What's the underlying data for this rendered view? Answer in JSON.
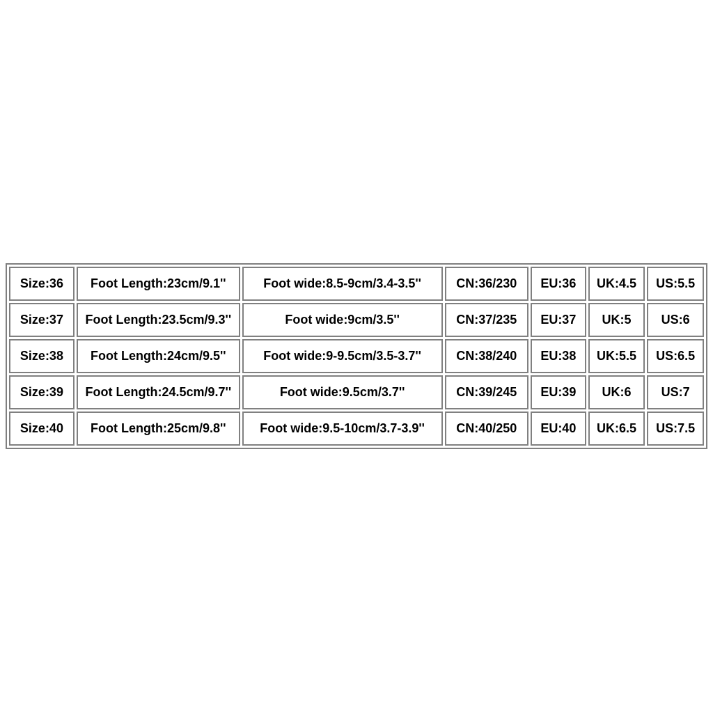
{
  "chart_data": {
    "type": "table",
    "columns": [
      "Size",
      "Foot Length",
      "Foot wide",
      "CN",
      "EU",
      "UK",
      "US"
    ],
    "rows": [
      {
        "size": "Size:36",
        "length": "Foot Length:23cm/9.1''",
        "wide": "Foot wide:8.5-9cm/3.4-3.5''",
        "cn": "CN:36/230",
        "eu": "EU:36",
        "uk": "UK:4.5",
        "us": "US:5.5"
      },
      {
        "size": "Size:37",
        "length": "Foot Length:23.5cm/9.3''",
        "wide": "Foot wide:9cm/3.5''",
        "cn": "CN:37/235",
        "eu": "EU:37",
        "uk": "UK:5",
        "us": "US:6"
      },
      {
        "size": "Size:38",
        "length": "Foot Length:24cm/9.5''",
        "wide": "Foot wide:9-9.5cm/3.5-3.7''",
        "cn": "CN:38/240",
        "eu": "EU:38",
        "uk": "UK:5.5",
        "us": "US:6.5"
      },
      {
        "size": "Size:39",
        "length": "Foot Length:24.5cm/9.7''",
        "wide": "Foot wide:9.5cm/3.7''",
        "cn": "CN:39/245",
        "eu": "EU:39",
        "uk": "UK:6",
        "us": "US:7"
      },
      {
        "size": "Size:40",
        "length": "Foot Length:25cm/9.8''",
        "wide": "Foot wide:9.5-10cm/3.7-3.9''",
        "cn": "CN:40/250",
        "eu": "EU:40",
        "uk": "UK:6.5",
        "us": "US:7.5"
      }
    ]
  }
}
